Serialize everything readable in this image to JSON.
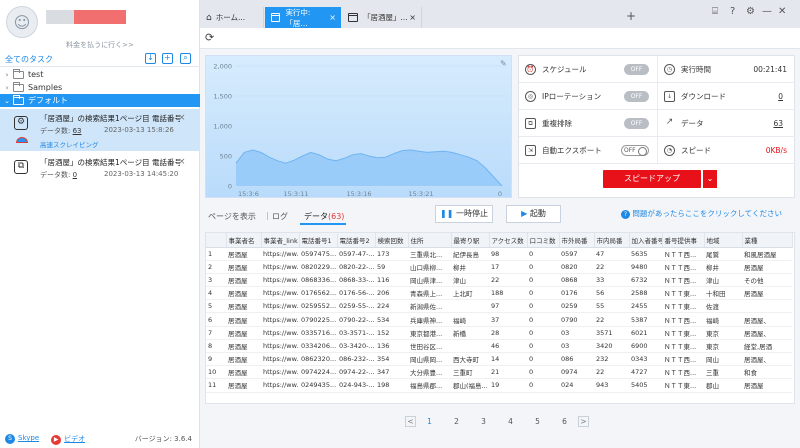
{
  "sidebar": {
    "pay_link": "料金を払うに行く>>",
    "all_tasks": "全てのタスク",
    "tree": [
      {
        "label": "test",
        "expanded": false
      },
      {
        "label": "Samples",
        "expanded": false
      },
      {
        "label": "デフォルト",
        "expanded": true
      }
    ],
    "tasks": [
      {
        "name": "「居酒屋」の検索結果1ページ目 電話番号検...",
        "count_label": "データ数:",
        "count": "63",
        "date": "2023-03-13 15:8:26",
        "status": "高速スクレイピング"
      },
      {
        "name": "「居酒屋」の検索結果1ページ目 電話番号検...",
        "count_label": "データ数:",
        "count": "0",
        "date": "2023-03-13 14:45:20"
      }
    ],
    "footer": {
      "skype": "Skype",
      "video": "ビデオ",
      "version": "バージョン: 3.6.4"
    }
  },
  "tabs": [
    {
      "label": "ホーム...",
      "active": false
    },
    {
      "label": "実行中:「居...",
      "active": true
    },
    {
      "label": "「居酒屋」...",
      "active": false
    }
  ],
  "chart_data": {
    "type": "area",
    "x": [
      "15:3:6",
      "15:3:11",
      "15:3:16",
      "15:3:21",
      "0"
    ],
    "yticks": [
      0,
      500,
      1000,
      1500,
      2000
    ],
    "ylim": [
      0,
      2000
    ],
    "values": [
      380,
      560,
      600,
      560,
      480,
      420,
      380,
      430,
      500,
      560,
      520,
      450,
      420,
      460,
      520,
      540,
      500,
      470,
      480,
      540,
      590,
      600,
      580,
      560,
      570,
      580,
      560,
      520,
      480,
      420,
      300,
      150,
      0
    ]
  },
  "stats": {
    "schedule": {
      "label": "スケジュール",
      "state": "OFF"
    },
    "ip_rotation": {
      "label": "IPローテーション",
      "state": "OFF"
    },
    "dedup": {
      "label": "重複排除",
      "state": "OFF"
    },
    "auto_export": {
      "label": "自動エクスポート",
      "state": "OFF"
    },
    "run_time": {
      "label": "実行時間",
      "value": "00:21:41"
    },
    "download": {
      "label": "ダウンロード",
      "value": "0"
    },
    "data": {
      "label": "データ",
      "value": "63"
    },
    "speed": {
      "label": "スピード",
      "value": "0KB/s"
    },
    "speed_up_label": "スピードアップ"
  },
  "subtabs": {
    "view": "ページを表示",
    "log": "ログ",
    "data": "データ",
    "data_count": "(63)"
  },
  "controls": {
    "pause": "一時停止",
    "start": "起動",
    "help": "問題があったらここをクリックしてください"
  },
  "table": {
    "headers": [
      "",
      "事業者名",
      "事業者_link",
      "電話番号1",
      "電話番号2",
      "検索回数",
      "住所",
      "最寄り駅",
      "アクセス数",
      "口コミ数",
      "市外局番",
      "市内局番",
      "加入者番号",
      "番号提供事",
      "地域",
      "業種"
    ],
    "rows": [
      [
        "1",
        "居酒屋",
        "https://ww...",
        "0597475...",
        "0597-47-...",
        "173",
        "三重県北...",
        "紀伊長島",
        "98",
        "0",
        "0597",
        "47",
        "5635",
        "ＮＴＴ西...",
        "尾鷲",
        "和風居酒屋"
      ],
      [
        "2",
        "居酒屋",
        "https://ww...",
        "0820229...",
        "0820-22-...",
        "59",
        "山口県柳...",
        "柳井",
        "17",
        "0",
        "0820",
        "22",
        "9480",
        "ＮＴＴ西...",
        "柳井",
        "居酒屋"
      ],
      [
        "3",
        "居酒屋",
        "https://ww...",
        "0868336...",
        "0868-33-...",
        "116",
        "岡山県津...",
        "津山",
        "22",
        "0",
        "0868",
        "33",
        "6732",
        "ＮＴＴ西...",
        "津山",
        "その他"
      ],
      [
        "4",
        "居酒屋",
        "https://ww...",
        "0176562...",
        "0176-56-...",
        "206",
        "青森県上...",
        "上北町",
        "188",
        "0",
        "0176",
        "56",
        "2588",
        "ＮＴＴ東...",
        "十和田",
        "居酒屋"
      ],
      [
        "5",
        "居酒屋",
        "https://ww...",
        "0259552...",
        "0259-55-...",
        "224",
        "新潟県佐...",
        "",
        "97",
        "0",
        "0259",
        "55",
        "2455",
        "ＮＴＴ東...",
        "佐渡",
        ""
      ],
      [
        "6",
        "居酒屋",
        "https://ww...",
        "0790225...",
        "0790-22-...",
        "534",
        "兵庫県神...",
        "福崎",
        "37",
        "0",
        "0790",
        "22",
        "5387",
        "ＮＴＴ西...",
        "福崎",
        "居酒屋、"
      ],
      [
        "7",
        "居酒屋",
        "https://ww...",
        "0335716...",
        "03-3571-...",
        "152",
        "東京都港...",
        "新橋",
        "28",
        "0",
        "03",
        "3571",
        "6021",
        "ＮＴＴ東...",
        "東京",
        "居酒屋、"
      ],
      [
        "8",
        "居酒屋",
        "https://ww...",
        "0334206...",
        "03-3420-...",
        "136",
        "世田谷区...",
        "",
        "46",
        "0",
        "03",
        "3420",
        "6900",
        "ＮＴＴ東...",
        "東京",
        "経堂,居酒"
      ],
      [
        "9",
        "居酒屋",
        "https://ww...",
        "0862320...",
        "086-232-...",
        "354",
        "岡山県岡...",
        "西大寺町",
        "14",
        "0",
        "086",
        "232",
        "0343",
        "ＮＴＴ西...",
        "岡山",
        "居酒屋、"
      ],
      [
        "10",
        "居酒屋",
        "https://ww...",
        "0974224...",
        "0974-22-...",
        "347",
        "大分県豊...",
        "三重町",
        "21",
        "0",
        "0974",
        "22",
        "4727",
        "ＮＴＴ西...",
        "三重",
        "和食"
      ],
      [
        "11",
        "居酒屋",
        "https://ww...",
        "0249435...",
        "024-943-...",
        "198",
        "福島県郡...",
        "郡山(福島...",
        "19",
        "0",
        "024",
        "943",
        "5405",
        "ＮＴＴ東...",
        "郡山",
        "居酒屋"
      ]
    ]
  },
  "pagination": {
    "pages": [
      "1",
      "2",
      "3",
      "4",
      "5",
      "6"
    ],
    "current": "1",
    "prev": "<",
    "next": ">"
  },
  "colors": {
    "accent": "#2196f3",
    "speed_button": "#e8111a"
  }
}
